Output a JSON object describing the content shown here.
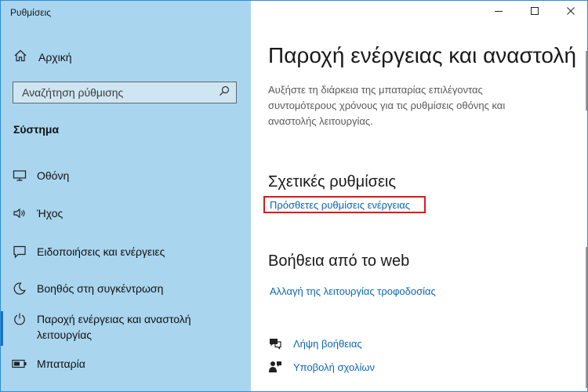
{
  "window": {
    "title": "Ρυθμίσεις"
  },
  "sidebar": {
    "home_label": "Αρχική",
    "search_placeholder": "Αναζήτηση ρύθμισης",
    "section_title": "Σύστημα",
    "items": [
      {
        "label": "Οθόνη",
        "icon": "monitor-icon"
      },
      {
        "label": "Ήχος",
        "icon": "speaker-icon"
      },
      {
        "label": "Ειδοποιήσεις και ενέργειες",
        "icon": "notification-icon"
      },
      {
        "label": "Βοηθός στη συγκέντρωση",
        "icon": "moon-icon"
      },
      {
        "label": "Παροχή ενέργειας και αναστολή λειτουργίας",
        "icon": "power-icon",
        "active": true
      },
      {
        "label": "Μπαταρία",
        "icon": "battery-icon"
      }
    ]
  },
  "main": {
    "page_title": "Παροχή ενέργειας και αναστολή λειτουργίας",
    "description": "Αυξήστε τη διάρκεια της μπαταρίας επιλέγοντας συντομότερους χρόνους για τις ρυθμίσεις οθόνης και αναστολής λειτουργίας.",
    "related_title": "Σχετικές ρυθμίσεις",
    "related_link": "Πρόσθετες ρυθμίσεις ενέργειας",
    "help_title": "Βοήθεια από το web",
    "help_link": "Αλλαγή της λειτουργίας τροφοδοσίας",
    "get_help": "Λήψη βοήθειας",
    "feedback": "Υποβολή σχολίων"
  },
  "colors": {
    "sidebar_bg": "#a9d5ee",
    "accent": "#0a66b8",
    "highlight": "#e01818"
  }
}
